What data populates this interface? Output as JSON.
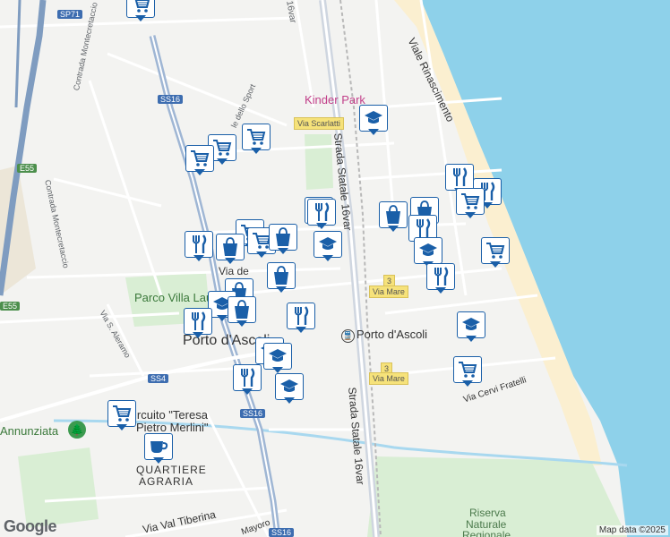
{
  "map": {
    "colors": {
      "sea": "#8ed1ea",
      "beach": "#fbefd0",
      "land": "#f3f3f1",
      "park": "#d9eed4",
      "road": "#ffffff",
      "highway": "#7f9cc0",
      "poi": "#1a5fa8",
      "river": "#a8d8ef"
    },
    "labels": {
      "sp71": "SP71",
      "contrada_montecretaccio_1": "Contrada Montecretaccio",
      "contrada_montecretaccio_2": "Contrada Montecretaccio",
      "ss16_north": "SS16",
      "e55_north": "E55",
      "e55_south": "E55",
      "sport": "le dello Sport",
      "strada_statale_16var_top": "16var",
      "kinder_park": "Kinder Park",
      "via_scarlatti": "Via Scarlatti",
      "strada_statale_16var_mid": "Strada Statale 16var",
      "viale_rinascimento": "Viale Rinascimento",
      "via_de": "Via de",
      "via_mare_1": "Via Mare",
      "shield_3_a": "3",
      "parco_villa_laureati": "Parco Villa Laureati",
      "via_s_alerano": "Via S. Aleramo",
      "porto_d_ascoli_town": "Porto d'Ascoli",
      "porto_d_ascoli_station": "Porto d'Ascoli",
      "via_mare_2": "Via Mare",
      "shield_3_b": "3",
      "ss4": "SS4",
      "ss16_mid": "SS16",
      "via_cervi_fratelli": "Via Cervi Fratelli",
      "annunziata": "Annunziata",
      "circuito": "ircuito \"Teresa",
      "circuito_2": "Pietro Merlini\"",
      "quartiere_agraria_1": "QUARTIERE",
      "quartiere_agraria_2": "AGRARIA",
      "strada_statale_16var_bottom": "Strada Statale 16var",
      "riserva_1": "Riserva",
      "riserva_2": "Naturale",
      "riserva_3": "Regionale",
      "via_val_tiberina": "Via Val Tiberina",
      "ss16_south": "SS16",
      "via_mayoro": "Mayoro"
    },
    "attribution": "Map data ©2025",
    "logo": "Google"
  },
  "pois": [
    {
      "icon": "shopping-cart-icon",
      "name": "Supermarket"
    },
    {
      "icon": "shopping-cart-icon",
      "name": "Supermarket"
    },
    {
      "icon": "shopping-cart-icon",
      "name": "Supermarket"
    },
    {
      "icon": "shopping-cart-icon",
      "name": "Supermarket"
    },
    {
      "icon": "education-icon",
      "name": "School"
    },
    {
      "icon": "restaurant-icon",
      "name": "Restaurant"
    },
    {
      "icon": "restaurant-icon",
      "name": "Restaurant"
    },
    {
      "icon": "shopping-cart-icon",
      "name": "Supermarket"
    },
    {
      "icon": "restaurant-icon",
      "name": "Restaurant"
    },
    {
      "icon": "shopping-bag-icon",
      "name": "Shop"
    },
    {
      "icon": "shopping-bag-icon",
      "name": "Shop"
    },
    {
      "icon": "shopping-cart-icon",
      "name": "Supermarket"
    },
    {
      "icon": "restaurant-icon",
      "name": "Restaurant"
    },
    {
      "icon": "restaurant-icon",
      "name": "Restaurant"
    },
    {
      "icon": "shopping-bag-icon",
      "name": "Shop"
    },
    {
      "icon": "shopping-cart-icon",
      "name": "Supermarket"
    },
    {
      "icon": "education-icon",
      "name": "School"
    },
    {
      "icon": "shopping-bag-icon",
      "name": "Shop"
    },
    {
      "icon": "education-icon",
      "name": "School"
    },
    {
      "icon": "restaurant-icon",
      "name": "Restaurant"
    },
    {
      "icon": "shopping-bag-icon",
      "name": "Shop"
    },
    {
      "icon": "education-icon",
      "name": "School"
    },
    {
      "icon": "restaurant-icon",
      "name": "Restaurant"
    },
    {
      "icon": "shopping-bag-icon",
      "name": "Shop"
    },
    {
      "icon": "restaurant-icon",
      "name": "Restaurant"
    },
    {
      "icon": "education-icon",
      "name": "School"
    },
    {
      "icon": "restaurant-icon",
      "name": "Restaurant"
    },
    {
      "icon": "education-icon",
      "name": "School"
    },
    {
      "icon": "shopping-cart-icon",
      "name": "Supermarket"
    },
    {
      "icon": "cafe-icon",
      "name": "Cafe"
    },
    {
      "icon": "shopping-cart-icon",
      "name": "Supermarket"
    },
    {
      "icon": "education-icon",
      "name": "School"
    },
    {
      "icon": "shopping-cart-icon",
      "name": "Supermarket"
    },
    {
      "icon": "restaurant-icon",
      "name": "Restaurant"
    },
    {
      "icon": "shopping-bag-icon",
      "name": "Shop"
    },
    {
      "icon": "education-icon",
      "name": "School"
    }
  ]
}
